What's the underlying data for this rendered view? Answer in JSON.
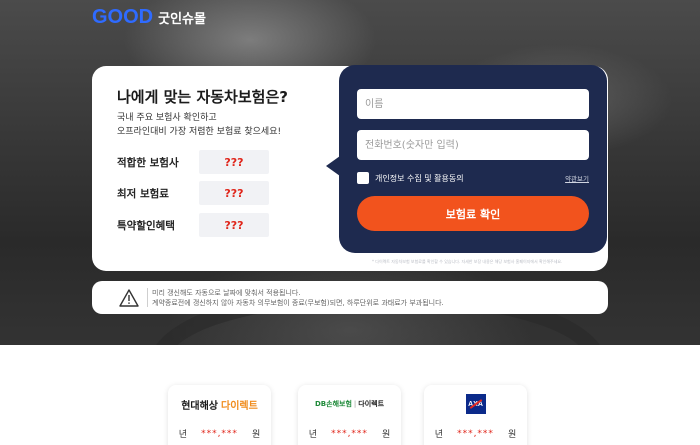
{
  "brand": {
    "logo_word": "GOOD",
    "logo_kor": "굿인슈몰",
    "color": "#2f6bff"
  },
  "card": {
    "title": "나에게 맞는 자동차보험은?",
    "subtitle_line1": "국내 주요 보험사 확인하고",
    "subtitle_line2": "오프라인대비 가장 저렴한 보험료 찾으세요!",
    "rows": [
      {
        "label": "적합한 보험사",
        "value": "???"
      },
      {
        "label": "최저 보험료",
        "value": "???"
      },
      {
        "label": "특약할인혜택",
        "value": "???"
      }
    ]
  },
  "form": {
    "name_placeholder": "이름",
    "phone_placeholder": "전화번호(숫자만 입력)",
    "agree_label": "개인정보 수집 및 활용동의",
    "terms_link": "약관보기",
    "submit_label": "보험료 확인",
    "fineprint": "* 다이렉트 자동차보험 보험료를 확인할 수 있습니다. 자세한 보장 내용은 해당 보험사 홈페이지에서 확인해주세요.",
    "accent_color": "#f2531d",
    "panel_color": "#1e2a4f"
  },
  "notice": {
    "line1": "미리 갱신해도 자동으로 날짜에 맞춰서 적용됩니다.",
    "line2": "계약종료전에 갱신하지 않아 자동차 의무보험이 종료(무보험)되면, 하루단위로 과태료가 부과됩니다."
  },
  "insurers": [
    {
      "name": "현대해상",
      "sub": "다이렉트",
      "unit_year": "년",
      "masked": "***,***",
      "unit_won": "원"
    },
    {
      "name": "DB손해보험",
      "sub": "다이렉트",
      "unit_year": "년",
      "masked": "***,***",
      "unit_won": "원"
    },
    {
      "name": "AXA",
      "sub": "",
      "unit_year": "년",
      "masked": "***,***",
      "unit_won": "원"
    }
  ]
}
